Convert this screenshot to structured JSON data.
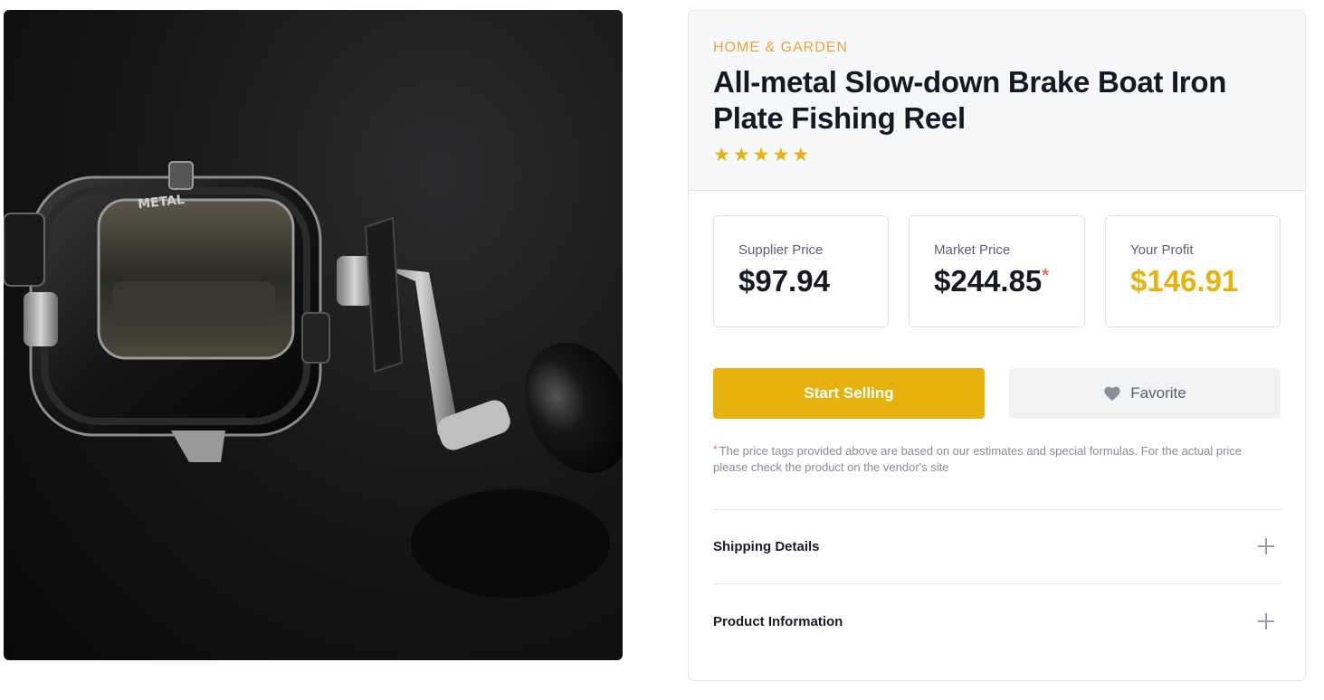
{
  "product_image": {
    "alt": "All-metal Slow-down Brake Boat Iron Plate Fishing Reel",
    "engraving": "METAL"
  },
  "product": {
    "category": "HOME & GARDEN",
    "title": "All-metal Slow-down Brake Boat Iron Plate Fishing Reel",
    "rating": 5,
    "stars": [
      "★",
      "★",
      "★",
      "★",
      "★"
    ]
  },
  "prices": {
    "supplier": {
      "label": "Supplier Price",
      "value": "$97.94"
    },
    "market": {
      "label": "Market Price",
      "value": "$244.85",
      "marker": "*"
    },
    "profit": {
      "label": "Your Profit",
      "value": "$146.91"
    }
  },
  "actions": {
    "start_selling": "Start Selling",
    "favorite": "Favorite"
  },
  "note": {
    "marker": "*",
    "text": "The price tags provided above are based on our estimates and special formulas. For the actual price please check the product on the vendor's site"
  },
  "accordions": {
    "shipping": "Shipping Details",
    "product_info": "Product Information"
  },
  "colors": {
    "accent": "#e8b20e",
    "category": "#e8a33b",
    "asterisk": "#f26a5a"
  }
}
